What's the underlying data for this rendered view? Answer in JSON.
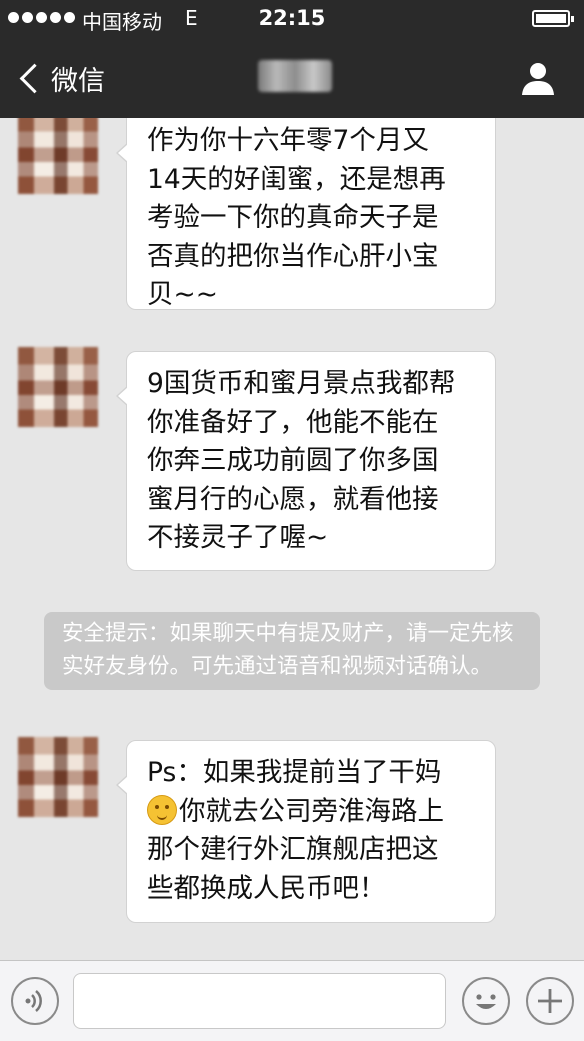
{
  "status_bar": {
    "carrier": "中国移动",
    "network": "E",
    "time": "22:15"
  },
  "nav": {
    "back_label": "微信"
  },
  "messages": [
    {
      "text": "作为你十六年零7个月又\n14天的好闺蜜，还是想再\n考验一下你的真命天子是\n否真的把你当作心肝小宝\n贝~~"
    },
    {
      "text": "9国货币和蜜月景点我都帮\n你准备好了，他能不能在\n你奔三成功前圆了你多国\n蜜月行的心愿，就看他接\n不接灵子了喔~"
    },
    {
      "line1": "Ps：如果我提前当了干妈",
      "line2_rest": "你就去公司旁淮海路上",
      "line3": "那个建行外汇旗舰店把这",
      "line4": "些都换成人民币吧！"
    }
  ],
  "security_notice": "安全提示：如果聊天中有提及财产，请一定先核实好友身份。可先通过语音和视频对话确认。",
  "icons": {
    "back": "chevron-left-icon",
    "profile": "person-icon",
    "voice": "voice-icon",
    "emoji_face": "emoji-face-icon",
    "message_emoji": "thinking-emoji-icon",
    "add": "plus-icon"
  },
  "colors": {
    "header_bg": "#2a2a2a",
    "chat_bg": "#e6e6e6",
    "bubble_bg": "#ffffff",
    "notice_bg": "#c9c9c9"
  }
}
